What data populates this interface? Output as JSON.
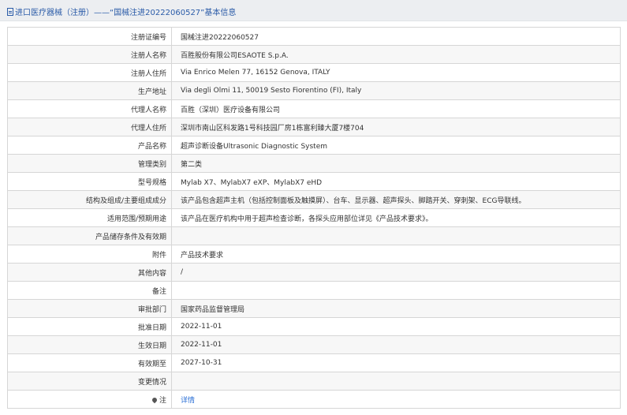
{
  "header": {
    "prefix": "进口医疗器械（注册）",
    "separator": "——",
    "record_title": "“国械注进20222060527”",
    "suffix": "基本信息"
  },
  "rows": [
    {
      "label": "注册证编号",
      "value": "国械注进20222060527"
    },
    {
      "label": "注册人名称",
      "value": "百胜股份有限公司ESAOTE S.p.A."
    },
    {
      "label": "注册人住所",
      "value": "Via Enrico Melen 77, 16152 Genova, ITALY"
    },
    {
      "label": "生产地址",
      "value": "Via degli Olmi 11, 50019 Sesto Fiorentino (FI), Italy"
    },
    {
      "label": "代理人名称",
      "value": "百胜（深圳）医疗设备有限公司"
    },
    {
      "label": "代理人住所",
      "value": "深圳市南山区科发路1号科技园厂房1栋富利臻大厦7楼704"
    },
    {
      "label": "产品名称",
      "value": "超声诊断设备Ultrasonic Diagnostic System"
    },
    {
      "label": "管理类别",
      "value": "第二类"
    },
    {
      "label": "型号规格",
      "value": "Mylab X7、MylabX7 eXP、MylabX7 eHD"
    },
    {
      "label": "结构及组成/主要组成成分",
      "value": "该产品包含超声主机（包括控制面板及触摸屏）、台车、显示器、超声探头、脚踏开关、穿刺架、ECG导联线。"
    },
    {
      "label": "适用范围/预期用途",
      "value": "该产品在医疗机构中用于超声检查诊断，各探头应用部位详见《产品技术要求》。"
    },
    {
      "label": "产品储存条件及有效期",
      "value": ""
    },
    {
      "label": "附件",
      "value": "产品技术要求"
    },
    {
      "label": "其他内容",
      "value": "/"
    },
    {
      "label": "备注",
      "value": ""
    },
    {
      "label": "审批部门",
      "value": "国家药品监督管理局"
    },
    {
      "label": "批准日期",
      "value": "2022-11-01"
    },
    {
      "label": "生效日期",
      "value": "2022-11-01"
    },
    {
      "label": "有效期至",
      "value": "2027-10-31"
    },
    {
      "label": "变更情况",
      "value": ""
    }
  ],
  "note_row": {
    "label": "注",
    "link_text": "详情"
  }
}
